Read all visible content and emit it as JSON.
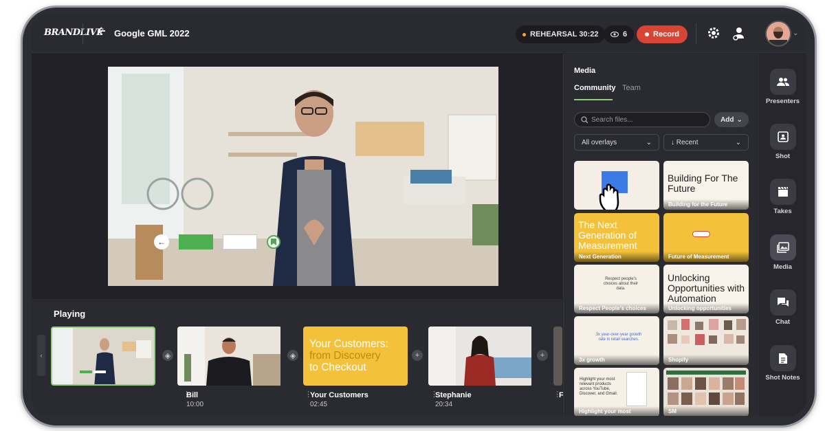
{
  "header": {
    "logo": "BRANDLIVE",
    "title": "Google GML 2022",
    "rehearsal": "REHEARSAL 30:22",
    "viewers": "6",
    "record_label": "Record"
  },
  "playing": {
    "label": "Playing",
    "collapse_arrow": "‹",
    "shots": [
      {
        "name": "",
        "time": ""
      },
      {
        "name": "Bill",
        "time": "10:00"
      },
      {
        "name": "Your Customers",
        "time": "02:45",
        "card_text": [
          "Your Customers:",
          "from Discovery",
          "to Checkout"
        ]
      },
      {
        "name": "Stephanie",
        "time": "20:34"
      },
      {
        "name": "F",
        "time": ""
      }
    ]
  },
  "media": {
    "title": "Media",
    "tabs": [
      "Community",
      "Team"
    ],
    "search_placeholder": "Search files...",
    "add_label": "Add",
    "filter_overlays": "All overlays",
    "filter_sort": "Recent",
    "tiles": [
      {
        "label": "",
        "headline": ""
      },
      {
        "label": "Building for the Future",
        "headline": "Building For The Future"
      },
      {
        "label": "Next Generation",
        "headline": "The Next Generation of Measurement"
      },
      {
        "label": "Future of Measurement",
        "headline": ""
      },
      {
        "label": "Respect People's choices",
        "headline": "Respect people's choices about their data."
      },
      {
        "label": "Unlocking opportunities",
        "headline": "Unlocking Opportunities with Automation"
      },
      {
        "label": "3x growth",
        "headline": "3x year-over-year growth rate in retail searches."
      },
      {
        "label": "Shopify",
        "headline": ""
      },
      {
        "label": "Highlight your most",
        "headline": "Highlight your most relevant products across YouTube, Discover, and Gmail."
      },
      {
        "label": "SM",
        "headline": ""
      }
    ]
  },
  "rail": [
    {
      "label": "Presenters",
      "icon": "presenters-icon"
    },
    {
      "label": "Shot",
      "icon": "shot-icon"
    },
    {
      "label": "Takes",
      "icon": "takes-icon"
    },
    {
      "label": "Media",
      "icon": "media-icon"
    },
    {
      "label": "Chat",
      "icon": "chat-icon"
    },
    {
      "label": "Shot Notes",
      "icon": "shot-notes-icon"
    }
  ],
  "colors": {
    "accent_green": "#8fcf7a",
    "record_red": "#d94434",
    "rehearsal_dot": "#f5a623",
    "card_yellow": "#f3c13a"
  }
}
